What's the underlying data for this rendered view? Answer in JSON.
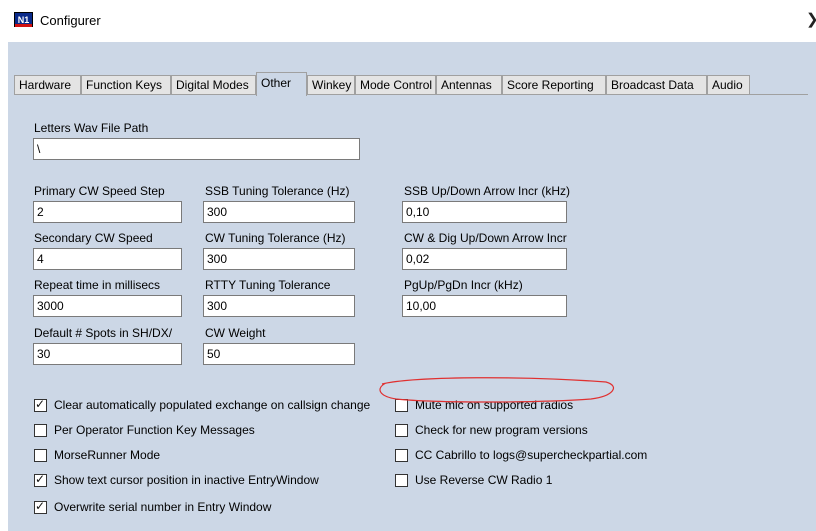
{
  "window": {
    "title": "Configurer",
    "icon_text": "N1",
    "close_glyph": "❯"
  },
  "tabs": [
    {
      "label": "Hardware",
      "active": false
    },
    {
      "label": "Function Keys",
      "active": false
    },
    {
      "label": "Digital Modes",
      "active": false
    },
    {
      "label": "Other",
      "active": true
    },
    {
      "label": "Winkey",
      "active": false
    },
    {
      "label": "Mode Control",
      "active": false
    },
    {
      "label": "Antennas",
      "active": false
    },
    {
      "label": "Score Reporting",
      "active": false
    },
    {
      "label": "Broadcast Data",
      "active": false
    },
    {
      "label": "Audio",
      "active": false
    }
  ],
  "fields": {
    "letters_wav": {
      "label": "Letters Wav File Path",
      "value": "\\"
    },
    "primary_cw_speed_step": {
      "label": "Primary CW Speed Step",
      "value": "2"
    },
    "ssb_tuning_tolerance": {
      "label": "SSB Tuning Tolerance (Hz)",
      "value": "300"
    },
    "ssb_arrow_incr": {
      "label": "SSB Up/Down Arrow Incr (kHz)",
      "value": "0,10"
    },
    "secondary_cw_speed": {
      "label": "Secondary CW Speed",
      "value": "4"
    },
    "cw_tuning_tolerance": {
      "label": "CW Tuning Tolerance (Hz)",
      "value": "300"
    },
    "cw_dig_arrow_incr": {
      "label": "CW & Dig Up/Down Arrow Incr",
      "value": "0,02"
    },
    "repeat_time": {
      "label": "Repeat time in millisecs",
      "value": "3000"
    },
    "rtty_tuning_tolerance": {
      "label": "RTTY Tuning Tolerance",
      "value": "300"
    },
    "pgup_pgdn_incr": {
      "label": "PgUp/PgDn Incr (kHz)",
      "value": "10,00"
    },
    "default_spots": {
      "label": "Default # Spots in SH/DX/",
      "value": "30"
    },
    "cw_weight": {
      "label": "CW Weight",
      "value": "50"
    }
  },
  "checkboxes": {
    "clear_exchange": {
      "label": "Clear automatically populated exchange on callsign change",
      "checked": true
    },
    "per_operator_keys": {
      "label": "Per Operator Function Key Messages",
      "checked": false
    },
    "morserunner": {
      "label": "MorseRunner Mode",
      "checked": false
    },
    "show_cursor": {
      "label": "Show text cursor position in inactive EntryWindow",
      "checked": true
    },
    "overwrite_serial": {
      "label": "Overwrite serial number in Entry Window",
      "checked": true
    },
    "mute_mic": {
      "label": "Mute mic on supported radios",
      "checked": false
    },
    "check_versions": {
      "label": "Check for new program versions",
      "checked": false
    },
    "cc_cabrillo": {
      "label": "CC Cabrillo to logs@supercheckpartial.com",
      "checked": false
    },
    "reverse_cw": {
      "label": "Use Reverse CW Radio 1",
      "checked": false
    }
  },
  "annotation_color": "#e03030"
}
